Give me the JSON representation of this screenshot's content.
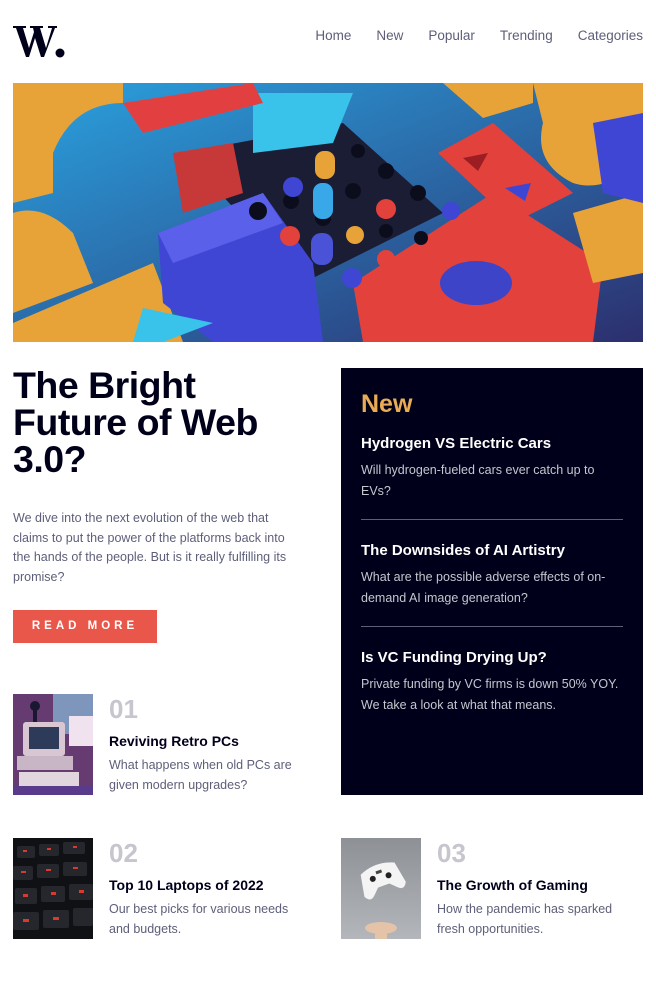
{
  "header": {
    "logo_text": "W.",
    "nav": [
      "Home",
      "New",
      "Popular",
      "Trending",
      "Categories"
    ]
  },
  "hero": {
    "image_alt": "colorful 3D wooden block composition"
  },
  "main": {
    "title": "The Bright Future of Web 3.0?",
    "lead": "We dive into the next evolution of the web that claims to put the power of the platforms back into the hands of the people. But is it really fulfilling its promise?",
    "cta_label": "READ MORE"
  },
  "new_panel": {
    "heading": "New",
    "items": [
      {
        "title": "Hydrogen VS Electric Cars",
        "desc": "Will hydrogen-fueled cars ever catch up to EVs?"
      },
      {
        "title": "The Downsides of AI Artistry",
        "desc": "What are the possible adverse effects of on-demand AI image generation?"
      },
      {
        "title": "Is VC Funding Drying Up?",
        "desc": "Private funding by VC firms is down 50% YOY. We take a look at what that means."
      }
    ]
  },
  "cards": [
    {
      "num": "01",
      "title": "Reviving Retro PCs",
      "desc": "What happens when old PCs are given modern upgrades?"
    },
    {
      "num": "02",
      "title": "Top 10 Laptops of 2022",
      "desc": "Our best picks for various needs and budgets."
    },
    {
      "num": "03",
      "title": "The Growth of Gaming",
      "desc": "How the pandemic has sparked fresh opportunities."
    }
  ],
  "colors": {
    "dark_navy": "#00001a",
    "soft_orange": "#e9ab53",
    "soft_red": "#e9574b",
    "grayish_blue": "#5d5f79",
    "light_gray": "#c5c6ce"
  }
}
